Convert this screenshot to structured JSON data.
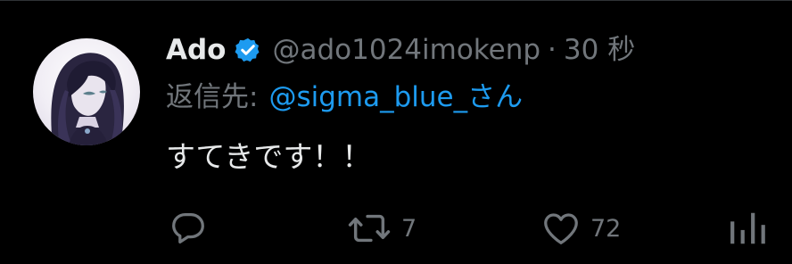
{
  "post": {
    "display_name": "Ado",
    "handle": "@ado1024imokenp",
    "separator": "·",
    "timestamp": "30 秒",
    "reply_prefix": "返信先:",
    "reply_to": "@sigma_blue_さん",
    "text": "すてきです！！"
  },
  "actions": {
    "reply_count": "",
    "repost_count": "7",
    "like_count": "72",
    "views_count": ""
  },
  "icons": {
    "verified": "verified-badge-icon",
    "reply": "reply-icon",
    "repost": "repost-icon",
    "like": "heart-icon",
    "views": "views-icon"
  },
  "colors": {
    "background": "#000000",
    "primary_text": "#e7e9ea",
    "secondary_text": "#71767b",
    "accent": "#1d9bf0"
  }
}
